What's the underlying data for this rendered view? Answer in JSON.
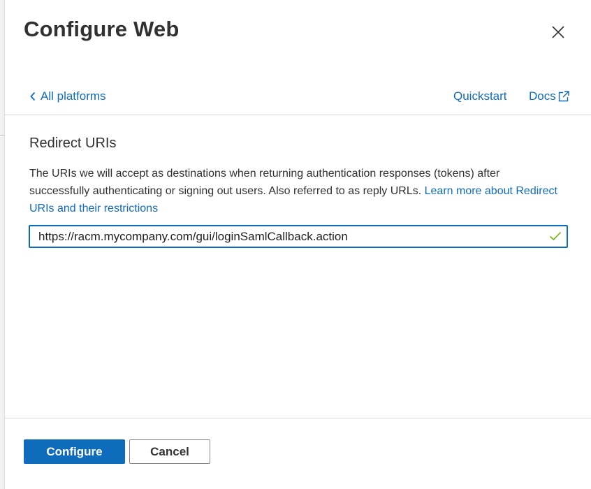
{
  "panel": {
    "title": "Configure Web",
    "close_icon": "close-icon"
  },
  "nav": {
    "back_label": "All platforms",
    "back_icon": "chevron-left-icon",
    "quickstart_label": "Quickstart",
    "docs_label": "Docs",
    "docs_icon": "external-link-icon"
  },
  "redirect": {
    "heading": "Redirect URIs",
    "description": "The URIs we will accept as destinations when returning authentication responses (tokens) after successfully authenticating or signing out users. Also referred to as reply URLs.",
    "learn_more_label": "Learn more about Redirect URIs and their restrictions",
    "uri_value": "https://racm.mycompany.com/gui/loginSamlCallback.action",
    "valid_icon": "checkmark-icon"
  },
  "footer": {
    "configure_label": "Configure",
    "cancel_label": "Cancel"
  },
  "colors": {
    "accent": "#0f6cbd",
    "valid": "#6bb700",
    "text": "#323130"
  }
}
